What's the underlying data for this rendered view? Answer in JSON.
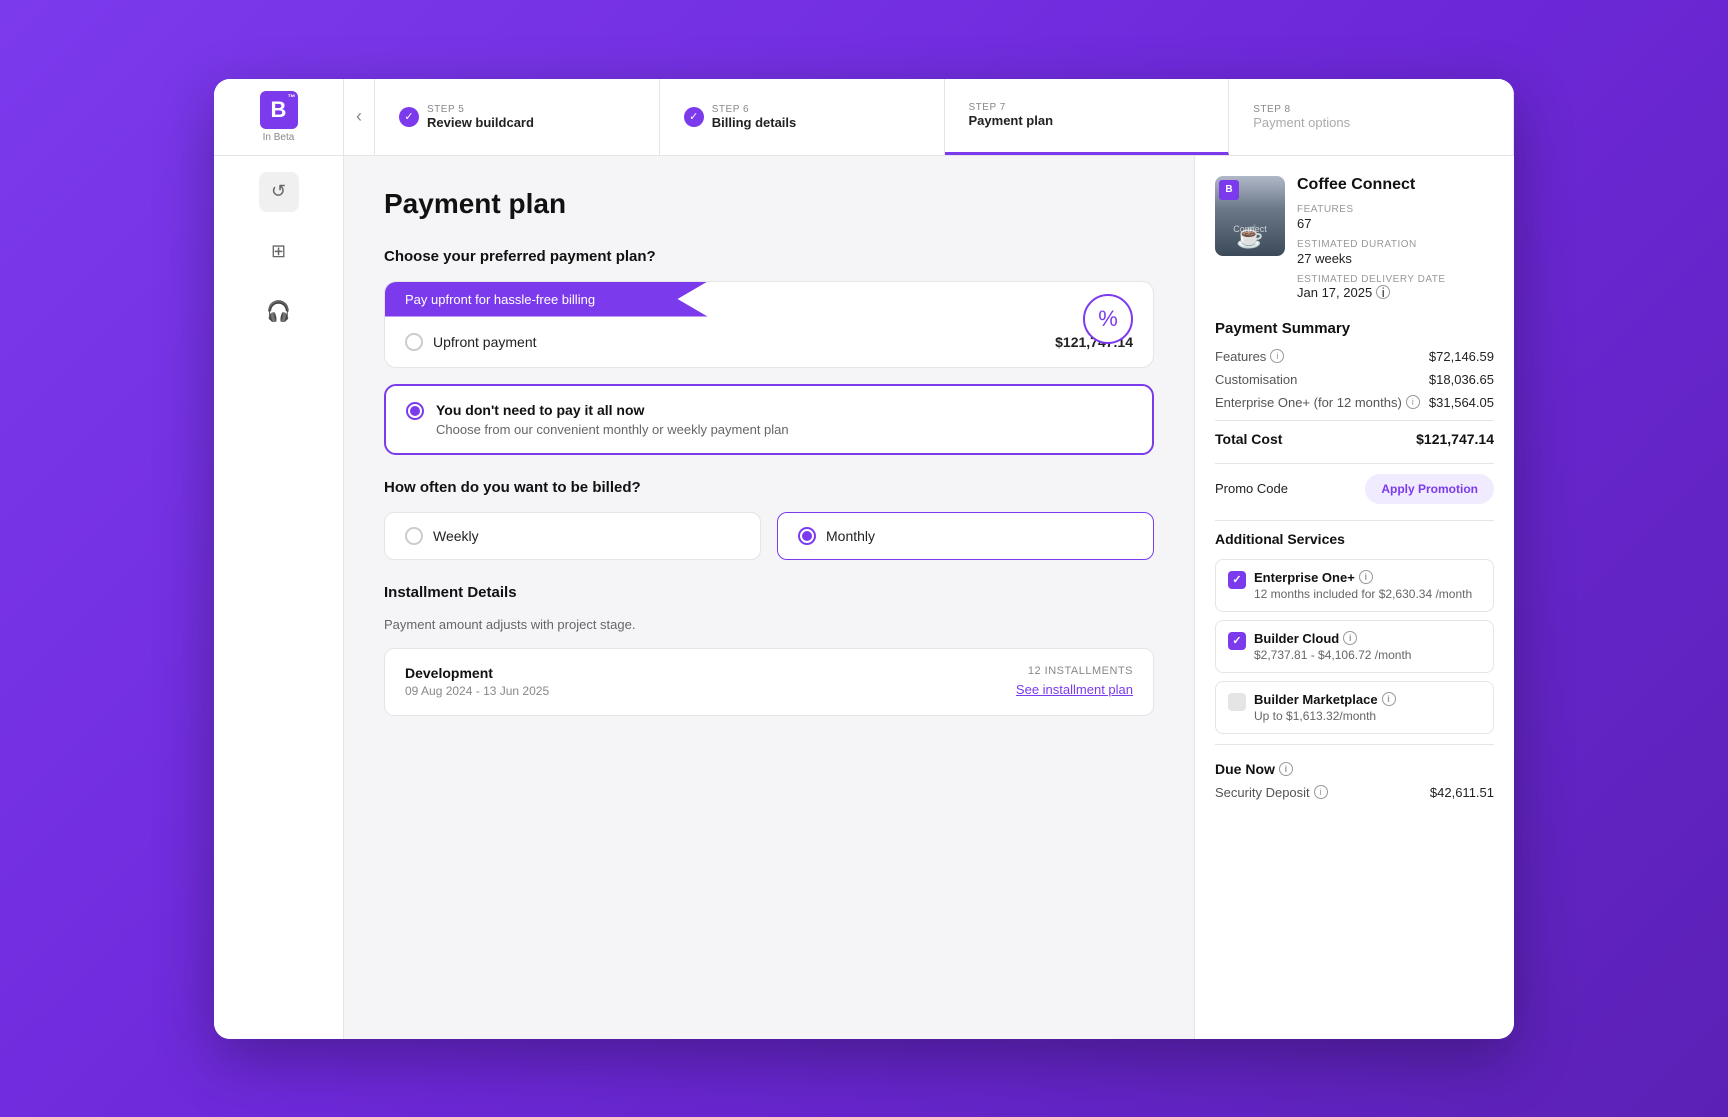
{
  "app": {
    "logo": "B",
    "logo_tm": "™",
    "logo_beta": "In Beta"
  },
  "header": {
    "back_icon": "‹",
    "steps": [
      {
        "id": "step5",
        "number": "STEP 5",
        "label": "Review buildcard",
        "status": "completed"
      },
      {
        "id": "step6",
        "number": "STEP 6",
        "label": "Billing details",
        "status": "completed"
      },
      {
        "id": "step7",
        "number": "STEP 7",
        "label": "Payment plan",
        "status": "active"
      },
      {
        "id": "step8",
        "number": "STEP 8",
        "label": "Payment options",
        "status": "inactive"
      }
    ]
  },
  "sidebar": {
    "icons": [
      {
        "name": "undo",
        "symbol": "↺"
      },
      {
        "name": "grid",
        "symbol": "⊞"
      },
      {
        "name": "support",
        "symbol": "🎧"
      }
    ]
  },
  "page": {
    "title": "Payment plan",
    "section1_label": "Choose your preferred payment plan?",
    "upfront": {
      "banner_text": "Pay upfront for hassle-free billing",
      "label": "Upfront payment",
      "price": "$121,747.14",
      "discount_icon": "%"
    },
    "installment": {
      "title": "You don't need to pay it all now",
      "subtitle": "Choose from our convenient monthly or weekly payment plan"
    },
    "section2_label": "How often do you want to be billed?",
    "billing_options": [
      {
        "id": "weekly",
        "label": "Weekly",
        "selected": false
      },
      {
        "id": "monthly",
        "label": "Monthly",
        "selected": true
      }
    ],
    "installment_details": {
      "title": "Installment Details",
      "subtitle": "Payment amount adjusts with project stage.",
      "row": {
        "title": "Development",
        "dates": "09 Aug 2024 - 13 Jun 2025",
        "count_label": "12 INSTALLMENTS",
        "link": "See installment plan"
      }
    }
  },
  "right_panel": {
    "project": {
      "name": "Coffee Connect",
      "thumb_logo": "B",
      "thumb_connect": "Connect",
      "features_label": "FEATURES",
      "features_value": "67",
      "duration_label": "ESTIMATED DURATION",
      "duration_value": "27 weeks",
      "delivery_label": "ESTIMATED DELIVERY DATE",
      "delivery_value": "Jan 17, 2025"
    },
    "payment_summary": {
      "title": "Payment Summary",
      "rows": [
        {
          "label": "Features",
          "value": "$72,146.59",
          "has_info": true
        },
        {
          "label": "Customisation",
          "value": "$18,036.65",
          "has_info": false
        },
        {
          "label": "Enterprise One+ (for 12 months)",
          "value": "$31,564.05",
          "has_info": true
        },
        {
          "label": "Total Cost",
          "value": "$121,747.14",
          "is_total": true
        }
      ]
    },
    "promo": {
      "label": "Promo Code",
      "button": "Apply Promotion"
    },
    "additional_services": {
      "title": "Additional Services",
      "items": [
        {
          "name": "Enterprise One+",
          "detail": "12 months included for $2,630.34 /month",
          "checked": true
        },
        {
          "name": "Builder Cloud",
          "detail": "$2,737.81 - $4,106.72 /month",
          "checked": true
        },
        {
          "name": "Builder Marketplace",
          "detail": "Up to $1,613.32/month",
          "checked": false
        }
      ]
    },
    "due_now": {
      "title": "Due Now",
      "security_deposit_label": "Security Deposit",
      "security_deposit_value": "$42,611.51"
    }
  }
}
